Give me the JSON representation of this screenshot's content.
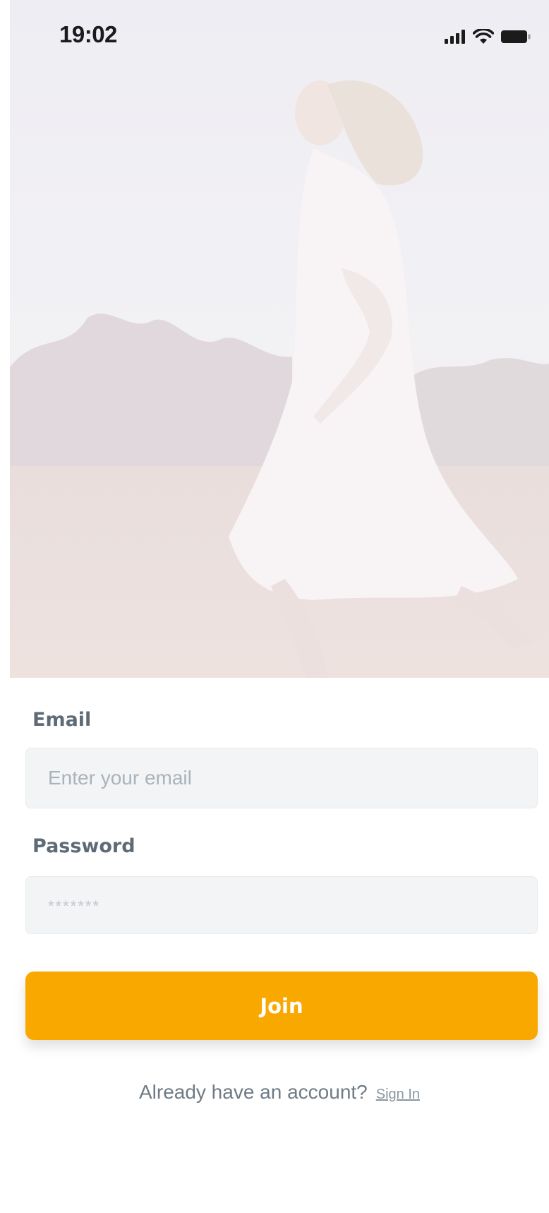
{
  "status_bar": {
    "time": "19:02"
  },
  "hero": {
    "description_icon": "photo-woman-running-in-field"
  },
  "form": {
    "email_label": "Email",
    "email_placeholder": "Enter your email",
    "email_value": "",
    "password_label": "Password",
    "password_placeholder": "*******",
    "password_value": "",
    "join_label": "Join"
  },
  "footer": {
    "prompt": "Already have an account?",
    "signin_label": "Sign In"
  },
  "colors": {
    "accent": "#f9a800",
    "label": "#5e6b76",
    "field_bg": "#f2f4f6"
  }
}
